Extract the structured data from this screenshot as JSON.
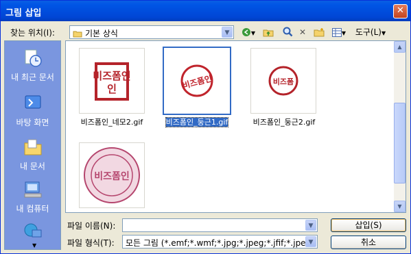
{
  "window": {
    "title": "그림 삽입",
    "close_label": "✕"
  },
  "lookin": {
    "label": "찾는 위치(I):",
    "value": "기본 상식"
  },
  "toolbar": {
    "back": "◀",
    "up": "▲",
    "search": "Q",
    "delete": "✕",
    "new_folder": "+",
    "views": "▦",
    "tools_label": "도구(L)"
  },
  "places": [
    {
      "label": "내 최근 문서"
    },
    {
      "label": "바탕 화면"
    },
    {
      "label": "내 문서"
    },
    {
      "label": "내 컴퓨터"
    },
    {
      "label": ""
    }
  ],
  "files": [
    {
      "name": "비즈폼인_네모2.gif",
      "selected": false,
      "seal_text": "비즈폼인"
    },
    {
      "name": "비즈폼인_둥근1.gif",
      "selected": true,
      "seal_text": "비즈폼인"
    },
    {
      "name": "비즈폼인_둥근2.gif",
      "selected": false,
      "seal_text": "비즈폼"
    },
    {
      "name": "",
      "selected": false,
      "seal_text": "비즈폼인"
    }
  ],
  "filename": {
    "label": "파일 이름(N):",
    "value": ""
  },
  "filetype": {
    "label": "파일 형식(T):",
    "value": "모든 그림 (*.emf;*.wmf;*.jpg;*.jpeg;*.jfif;*.jpe;"
  },
  "buttons": {
    "insert": "삽입(S)",
    "cancel": "취소"
  },
  "colors": {
    "title_bar": "#0054E3",
    "places_bg": "#7A96DF",
    "selection": "#316AC5",
    "seal_red": "#B4232A"
  }
}
